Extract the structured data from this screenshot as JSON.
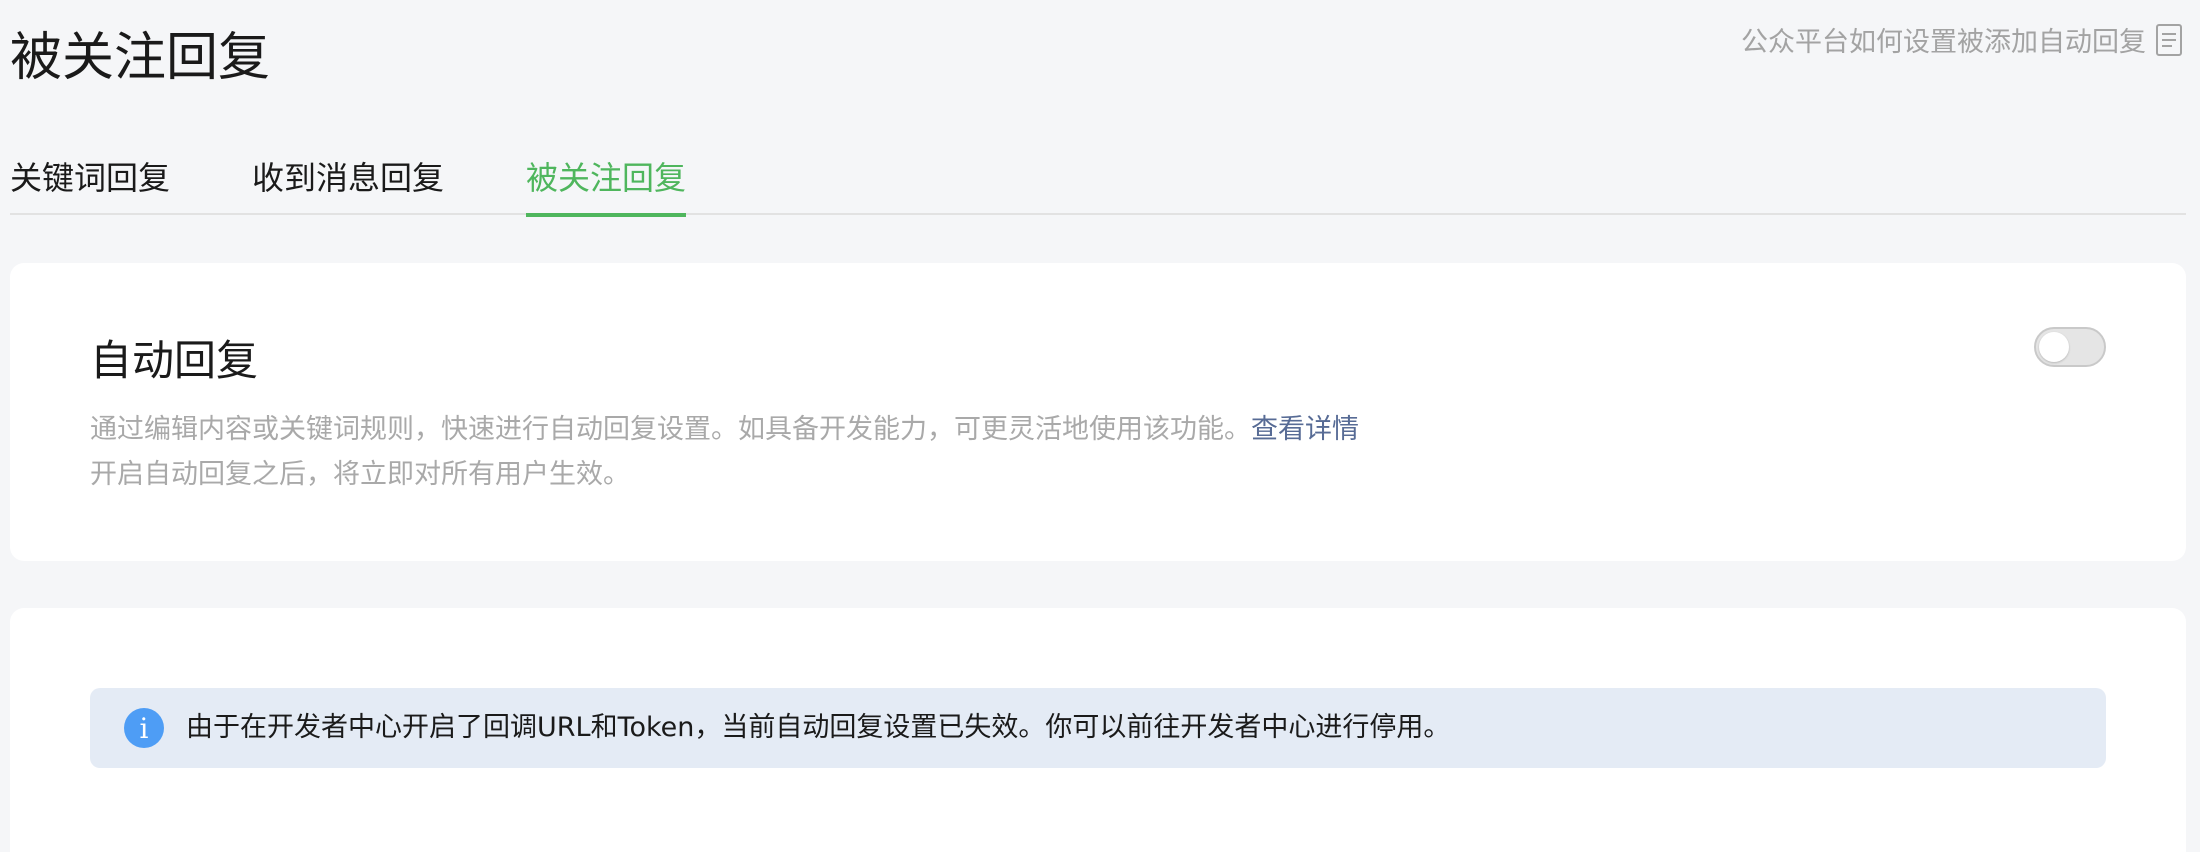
{
  "header": {
    "title": "被关注回复",
    "help_link": "公众平台如何设置被添加自动回复",
    "help_icon": "document-icon"
  },
  "tabs": [
    {
      "label": "关键词回复",
      "active": false
    },
    {
      "label": "收到消息回复",
      "active": false
    },
    {
      "label": "被关注回复",
      "active": true
    }
  ],
  "auto_reply": {
    "title": "自动回复",
    "desc_line1": "通过编辑内容或关键词规则，快速进行自动回复设置。如具备开发能力，可更灵活地使用该功能。",
    "details_link": "查看详情",
    "desc_line2": "开启自动回复之后，将立即对所有用户生效。",
    "toggle_on": false
  },
  "notice": {
    "icon": "info-icon",
    "icon_glyph": "i",
    "text": "由于在开发者中心开启了回调URL和Token，当前自动回复设置已失效。你可以前往开发者中心进行停用。"
  },
  "colors": {
    "accent": "#4fb65d",
    "link": "#576b95",
    "info": "#4e9df5",
    "notice_bg": "#e4ebf5"
  }
}
